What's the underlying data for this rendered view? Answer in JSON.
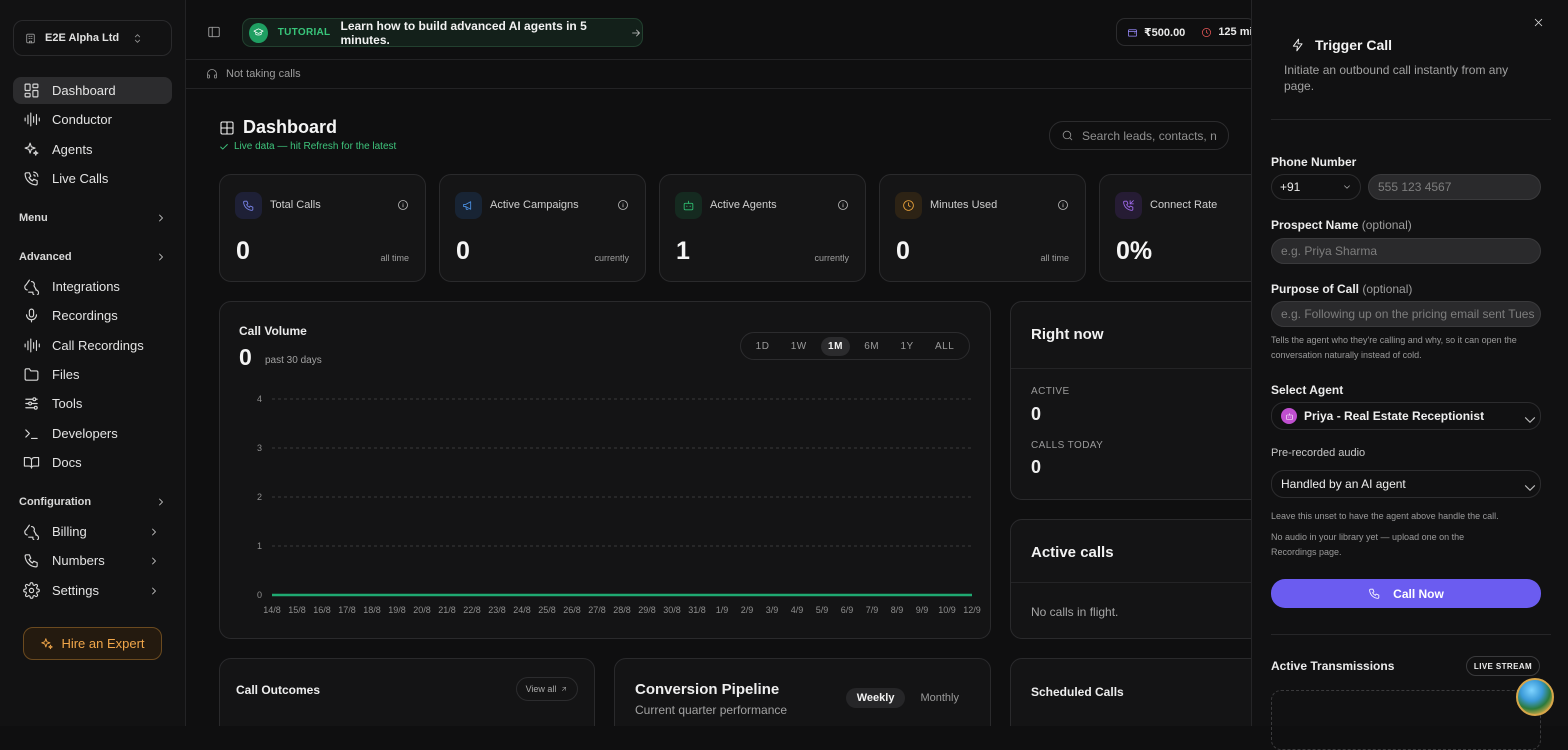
{
  "org": {
    "name": "E2E Alpha Ltd"
  },
  "sidebar": {
    "items": [
      {
        "label": "Dashboard"
      },
      {
        "label": "Conductor"
      },
      {
        "label": "Agents"
      },
      {
        "label": "Live Calls"
      }
    ],
    "menu_label": "Menu",
    "advanced_label": "Advanced",
    "advanced_items": [
      {
        "label": "Integrations"
      },
      {
        "label": "Recordings"
      },
      {
        "label": "Call Recordings"
      },
      {
        "label": "Files"
      },
      {
        "label": "Tools"
      },
      {
        "label": "Developers"
      },
      {
        "label": "Docs"
      }
    ],
    "configuration_label": "Configuration",
    "config_items": [
      {
        "label": "Billing"
      },
      {
        "label": "Numbers"
      },
      {
        "label": "Settings"
      }
    ],
    "hire_label": "Hire an Expert"
  },
  "topbar": {
    "tutorial_tag": "TUTORIAL",
    "tutorial_text": "Learn how to build advanced AI agents in 5 minutes.",
    "balance": "₹500.00",
    "minutes": "125 mi"
  },
  "status": {
    "text": "Not taking calls"
  },
  "dashboard": {
    "title": "Dashboard",
    "live_note": "Live data — hit Refresh for the latest",
    "search_placeholder": "Search leads, contacts, n"
  },
  "cards": [
    {
      "label": "Total Calls",
      "value": "0",
      "sub": "all time",
      "accent": "#6e7cf0"
    },
    {
      "label": "Active Campaigns",
      "value": "0",
      "sub": "currently",
      "accent": "#4a90e2"
    },
    {
      "label": "Active Agents",
      "value": "1",
      "sub": "currently",
      "accent": "#2fbf71"
    },
    {
      "label": "Minutes Used",
      "value": "0",
      "sub": "all time",
      "accent": "#e9a23b"
    },
    {
      "label": "Connect Rate",
      "value": "0%",
      "sub": "",
      "accent": "#a36cf0"
    }
  ],
  "call_volume": {
    "title": "Call Volume",
    "count": "0",
    "subtitle": "past 30 days",
    "ranges": [
      "1D",
      "1W",
      "1M",
      "6M",
      "1Y",
      "ALL"
    ],
    "selected_range": "1M"
  },
  "chart_data": {
    "type": "line",
    "x": [
      "14/8",
      "15/8",
      "16/8",
      "17/8",
      "18/8",
      "19/8",
      "20/8",
      "21/8",
      "22/8",
      "23/8",
      "24/8",
      "25/8",
      "26/8",
      "27/8",
      "28/8",
      "29/8",
      "30/8",
      "31/8",
      "1/9",
      "2/9",
      "3/9",
      "4/9",
      "5/9",
      "6/9",
      "7/9",
      "8/9",
      "9/9",
      "10/9",
      "12/9"
    ],
    "series": [
      {
        "values": [
          0,
          0,
          0,
          0,
          0,
          0,
          0,
          0,
          0,
          0,
          0,
          0,
          0,
          0,
          0,
          0,
          0,
          0,
          0,
          0,
          0,
          0,
          0,
          0,
          0,
          0,
          0,
          0,
          0
        ]
      }
    ],
    "yticks": [
      "0",
      "1",
      "2",
      "3",
      "4"
    ],
    "ylim": [
      0,
      4
    ],
    "grid": true,
    "color": "#1fa971",
    "title": "Call Volume",
    "xlabel": "",
    "ylabel": ""
  },
  "right_now": {
    "title": "Right now",
    "active_label": "ACTIVE",
    "active_value": "0",
    "today_label": "CALLS TODAY",
    "today_value": "0"
  },
  "active_calls": {
    "title": "Active calls",
    "empty": "No calls in flight."
  },
  "call_outcomes": {
    "title": "Call Outcomes",
    "view_all": "View all"
  },
  "pipeline": {
    "title": "Conversion Pipeline",
    "subtitle": "Current quarter performance",
    "weekly": "Weekly",
    "monthly": "Monthly"
  },
  "scheduled": {
    "title": "Scheduled Calls"
  },
  "trigger": {
    "title": "Trigger Call",
    "description": "Initiate an outbound call instantly from any page.",
    "phone_label": "Phone Number",
    "country_code": "+91",
    "phone_placeholder": "555 123 4567",
    "prospect_label": "Prospect Name",
    "optional": "(optional)",
    "prospect_placeholder": "e.g. Priya Sharma",
    "purpose_label": "Purpose of Call",
    "purpose_placeholder": "e.g. Following up on the pricing email sent Tues",
    "purpose_hint": "Tells the agent who they're calling and why, so it can open the conversation naturally instead of cold.",
    "agent_label": "Select Agent",
    "agent_value": "Priya - Real Estate Receptionist",
    "audio_label": "Pre-recorded audio",
    "audio_value": "Handled by an AI agent",
    "audio_hint": "Leave this unset to have the agent above handle the call.",
    "library_hint": "No audio in your library yet — upload one on the Recordings page.",
    "call_now": "Call Now",
    "transmissions_title": "Active Transmissions",
    "live_stream": "LIVE STREAM"
  }
}
